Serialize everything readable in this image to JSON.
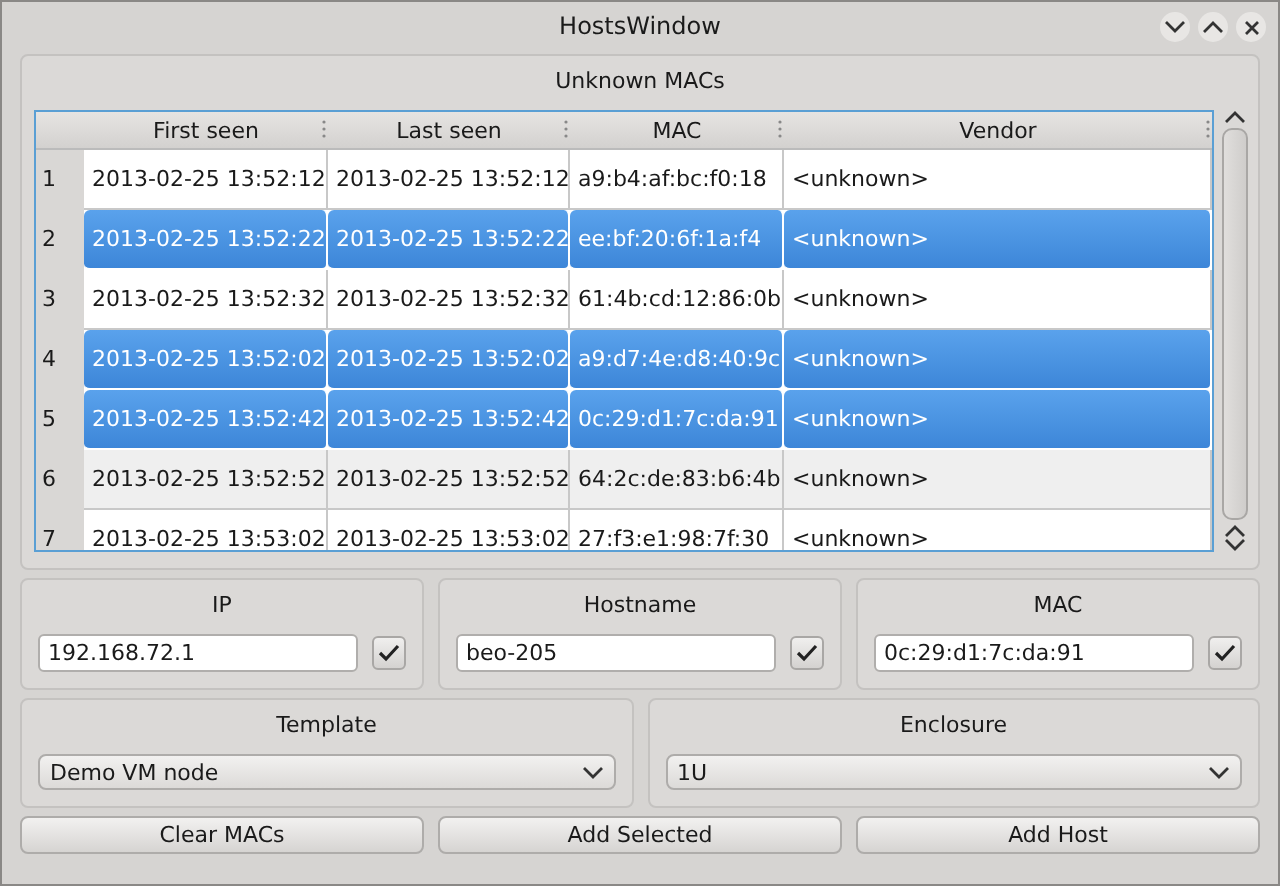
{
  "window": {
    "title": "HostsWindow"
  },
  "unknown_macs": {
    "title": "Unknown MACs",
    "columns": [
      "First seen",
      "Last seen",
      "MAC",
      "Vendor"
    ],
    "rows": [
      {
        "number": "1",
        "cells": [
          "2013-02-25 13:52:12",
          "2013-02-25 13:52:12",
          "a9:b4:af:bc:f0:18",
          "<unknown>"
        ],
        "selected": false
      },
      {
        "number": "2",
        "cells": [
          "2013-02-25 13:52:22",
          "2013-02-25 13:52:22",
          "ee:bf:20:6f:1a:f4",
          "<unknown>"
        ],
        "selected": true
      },
      {
        "number": "3",
        "cells": [
          "2013-02-25 13:52:32",
          "2013-02-25 13:52:32",
          "61:4b:cd:12:86:0b",
          "<unknown>"
        ],
        "selected": false
      },
      {
        "number": "4",
        "cells": [
          "2013-02-25 13:52:02",
          "2013-02-25 13:52:02",
          "a9:d7:4e:d8:40:9c",
          "<unknown>"
        ],
        "selected": true
      },
      {
        "number": "5",
        "cells": [
          "2013-02-25 13:52:42",
          "2013-02-25 13:52:42",
          "0c:29:d1:7c:da:91",
          "<unknown>"
        ],
        "selected": true
      },
      {
        "number": "6",
        "cells": [
          "2013-02-25 13:52:52",
          "2013-02-25 13:52:52",
          "64:2c:de:83:b6:4b",
          "<unknown>"
        ],
        "selected": false
      },
      {
        "number": "7",
        "cells": [
          "2013-02-25 13:53:02",
          "2013-02-25 13:53:02",
          "27:f3:e1:98:7f:30",
          "<unknown>"
        ],
        "selected": false
      }
    ]
  },
  "fields": [
    {
      "label": "IP",
      "value": "192.168.72.1"
    },
    {
      "label": "Hostname",
      "value": "beo-205"
    },
    {
      "label": "MAC",
      "value": "0c:29:d1:7c:da:91"
    }
  ],
  "selects": [
    {
      "label": "Template",
      "value": "Demo VM node"
    },
    {
      "label": "Enclosure",
      "value": "1U"
    }
  ],
  "buttons": [
    "Clear MACs",
    "Add Selected",
    "Add Host"
  ]
}
